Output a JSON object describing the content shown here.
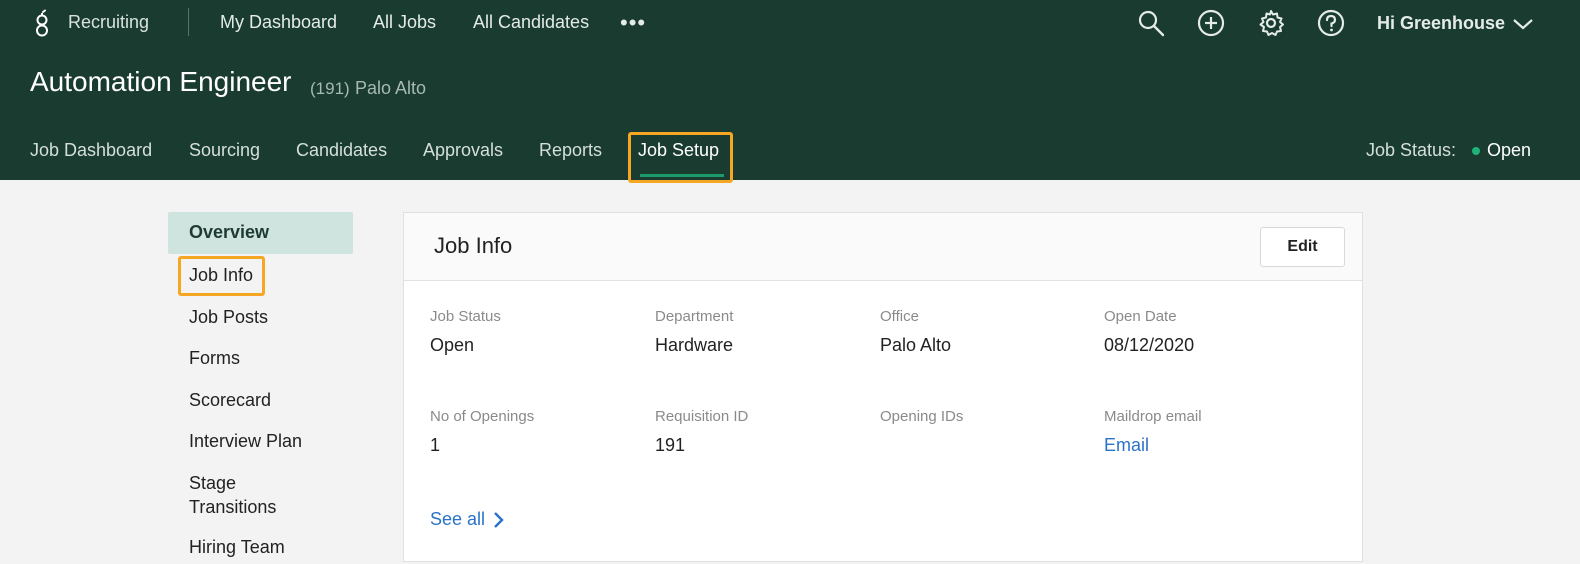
{
  "topnav": {
    "brand": "Recruiting",
    "links": [
      "My Dashboard",
      "All Jobs",
      "All Candidates"
    ],
    "more": "•••",
    "greeting": "Hi Greenhouse"
  },
  "job": {
    "title": "Automation Engineer",
    "count": "(191)",
    "location": "Palo Alto"
  },
  "tabs": [
    {
      "label": "Job Dashboard"
    },
    {
      "label": "Sourcing"
    },
    {
      "label": "Candidates"
    },
    {
      "label": "Approvals"
    },
    {
      "label": "Reports"
    },
    {
      "label": "Job Setup",
      "active": true
    }
  ],
  "job_status": {
    "label": "Job Status:",
    "value": "Open",
    "color": "#1fb37a"
  },
  "sidebar": {
    "items": [
      "Overview",
      "Job Info",
      "Job Posts",
      "Forms",
      "Scorecard",
      "Interview Plan",
      "Stage Transitions",
      "Hiring Team"
    ]
  },
  "panel": {
    "title": "Job Info",
    "edit_label": "Edit",
    "fields": [
      {
        "label": "Job Status",
        "value": "Open"
      },
      {
        "label": "Department",
        "value": "Hardware"
      },
      {
        "label": "Office",
        "value": "Palo Alto"
      },
      {
        "label": "Open Date",
        "value": "08/12/2020"
      },
      {
        "label": "No of Openings",
        "value": "1"
      },
      {
        "label": "Requisition ID",
        "value": "191"
      },
      {
        "label": "Opening IDs",
        "value": ""
      },
      {
        "label": "Maildrop email",
        "value": "Email"
      }
    ],
    "see_all": "See all"
  },
  "colors": {
    "header_bg": "#193b30",
    "accent": "#1d9a6c",
    "highlight": "#f5a623",
    "link": "#2a73c8",
    "overview_bg": "#cfe4df"
  },
  "icons": [
    "greenhouse-logo-icon",
    "more-icon",
    "search-icon",
    "plus-circle-icon",
    "gear-icon",
    "help-icon",
    "chevron-down-icon",
    "chevron-right-icon"
  ]
}
